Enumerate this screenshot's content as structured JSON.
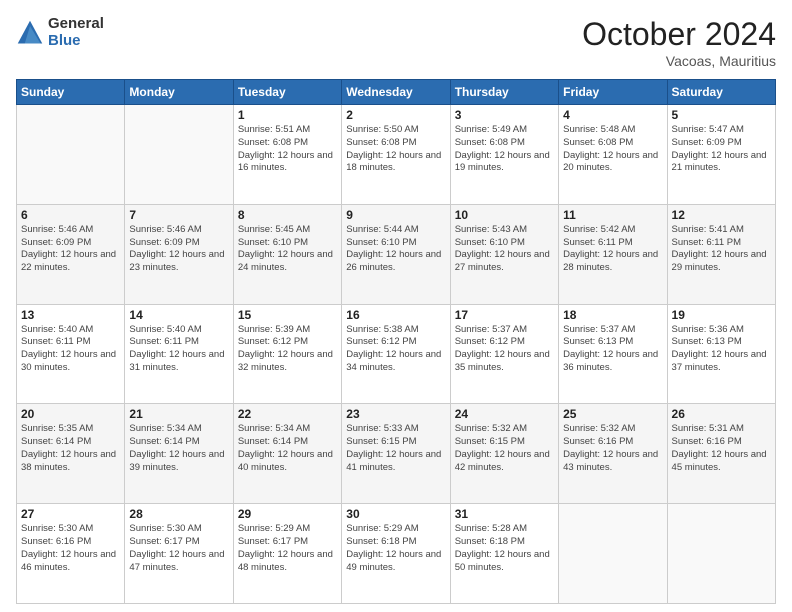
{
  "logo": {
    "general": "General",
    "blue": "Blue"
  },
  "header": {
    "month": "October 2024",
    "location": "Vacoas, Mauritius"
  },
  "weekdays": [
    "Sunday",
    "Monday",
    "Tuesday",
    "Wednesday",
    "Thursday",
    "Friday",
    "Saturday"
  ],
  "weeks": [
    [
      {
        "day": "",
        "detail": ""
      },
      {
        "day": "",
        "detail": ""
      },
      {
        "day": "1",
        "detail": "Sunrise: 5:51 AM\nSunset: 6:08 PM\nDaylight: 12 hours and 16 minutes."
      },
      {
        "day": "2",
        "detail": "Sunrise: 5:50 AM\nSunset: 6:08 PM\nDaylight: 12 hours and 18 minutes."
      },
      {
        "day": "3",
        "detail": "Sunrise: 5:49 AM\nSunset: 6:08 PM\nDaylight: 12 hours and 19 minutes."
      },
      {
        "day": "4",
        "detail": "Sunrise: 5:48 AM\nSunset: 6:08 PM\nDaylight: 12 hours and 20 minutes."
      },
      {
        "day": "5",
        "detail": "Sunrise: 5:47 AM\nSunset: 6:09 PM\nDaylight: 12 hours and 21 minutes."
      }
    ],
    [
      {
        "day": "6",
        "detail": "Sunrise: 5:46 AM\nSunset: 6:09 PM\nDaylight: 12 hours and 22 minutes."
      },
      {
        "day": "7",
        "detail": "Sunrise: 5:46 AM\nSunset: 6:09 PM\nDaylight: 12 hours and 23 minutes."
      },
      {
        "day": "8",
        "detail": "Sunrise: 5:45 AM\nSunset: 6:10 PM\nDaylight: 12 hours and 24 minutes."
      },
      {
        "day": "9",
        "detail": "Sunrise: 5:44 AM\nSunset: 6:10 PM\nDaylight: 12 hours and 26 minutes."
      },
      {
        "day": "10",
        "detail": "Sunrise: 5:43 AM\nSunset: 6:10 PM\nDaylight: 12 hours and 27 minutes."
      },
      {
        "day": "11",
        "detail": "Sunrise: 5:42 AM\nSunset: 6:11 PM\nDaylight: 12 hours and 28 minutes."
      },
      {
        "day": "12",
        "detail": "Sunrise: 5:41 AM\nSunset: 6:11 PM\nDaylight: 12 hours and 29 minutes."
      }
    ],
    [
      {
        "day": "13",
        "detail": "Sunrise: 5:40 AM\nSunset: 6:11 PM\nDaylight: 12 hours and 30 minutes."
      },
      {
        "day": "14",
        "detail": "Sunrise: 5:40 AM\nSunset: 6:11 PM\nDaylight: 12 hours and 31 minutes."
      },
      {
        "day": "15",
        "detail": "Sunrise: 5:39 AM\nSunset: 6:12 PM\nDaylight: 12 hours and 32 minutes."
      },
      {
        "day": "16",
        "detail": "Sunrise: 5:38 AM\nSunset: 6:12 PM\nDaylight: 12 hours and 34 minutes."
      },
      {
        "day": "17",
        "detail": "Sunrise: 5:37 AM\nSunset: 6:12 PM\nDaylight: 12 hours and 35 minutes."
      },
      {
        "day": "18",
        "detail": "Sunrise: 5:37 AM\nSunset: 6:13 PM\nDaylight: 12 hours and 36 minutes."
      },
      {
        "day": "19",
        "detail": "Sunrise: 5:36 AM\nSunset: 6:13 PM\nDaylight: 12 hours and 37 minutes."
      }
    ],
    [
      {
        "day": "20",
        "detail": "Sunrise: 5:35 AM\nSunset: 6:14 PM\nDaylight: 12 hours and 38 minutes."
      },
      {
        "day": "21",
        "detail": "Sunrise: 5:34 AM\nSunset: 6:14 PM\nDaylight: 12 hours and 39 minutes."
      },
      {
        "day": "22",
        "detail": "Sunrise: 5:34 AM\nSunset: 6:14 PM\nDaylight: 12 hours and 40 minutes."
      },
      {
        "day": "23",
        "detail": "Sunrise: 5:33 AM\nSunset: 6:15 PM\nDaylight: 12 hours and 41 minutes."
      },
      {
        "day": "24",
        "detail": "Sunrise: 5:32 AM\nSunset: 6:15 PM\nDaylight: 12 hours and 42 minutes."
      },
      {
        "day": "25",
        "detail": "Sunrise: 5:32 AM\nSunset: 6:16 PM\nDaylight: 12 hours and 43 minutes."
      },
      {
        "day": "26",
        "detail": "Sunrise: 5:31 AM\nSunset: 6:16 PM\nDaylight: 12 hours and 45 minutes."
      }
    ],
    [
      {
        "day": "27",
        "detail": "Sunrise: 5:30 AM\nSunset: 6:16 PM\nDaylight: 12 hours and 46 minutes."
      },
      {
        "day": "28",
        "detail": "Sunrise: 5:30 AM\nSunset: 6:17 PM\nDaylight: 12 hours and 47 minutes."
      },
      {
        "day": "29",
        "detail": "Sunrise: 5:29 AM\nSunset: 6:17 PM\nDaylight: 12 hours and 48 minutes."
      },
      {
        "day": "30",
        "detail": "Sunrise: 5:29 AM\nSunset: 6:18 PM\nDaylight: 12 hours and 49 minutes."
      },
      {
        "day": "31",
        "detail": "Sunrise: 5:28 AM\nSunset: 6:18 PM\nDaylight: 12 hours and 50 minutes."
      },
      {
        "day": "",
        "detail": ""
      },
      {
        "day": "",
        "detail": ""
      }
    ]
  ]
}
